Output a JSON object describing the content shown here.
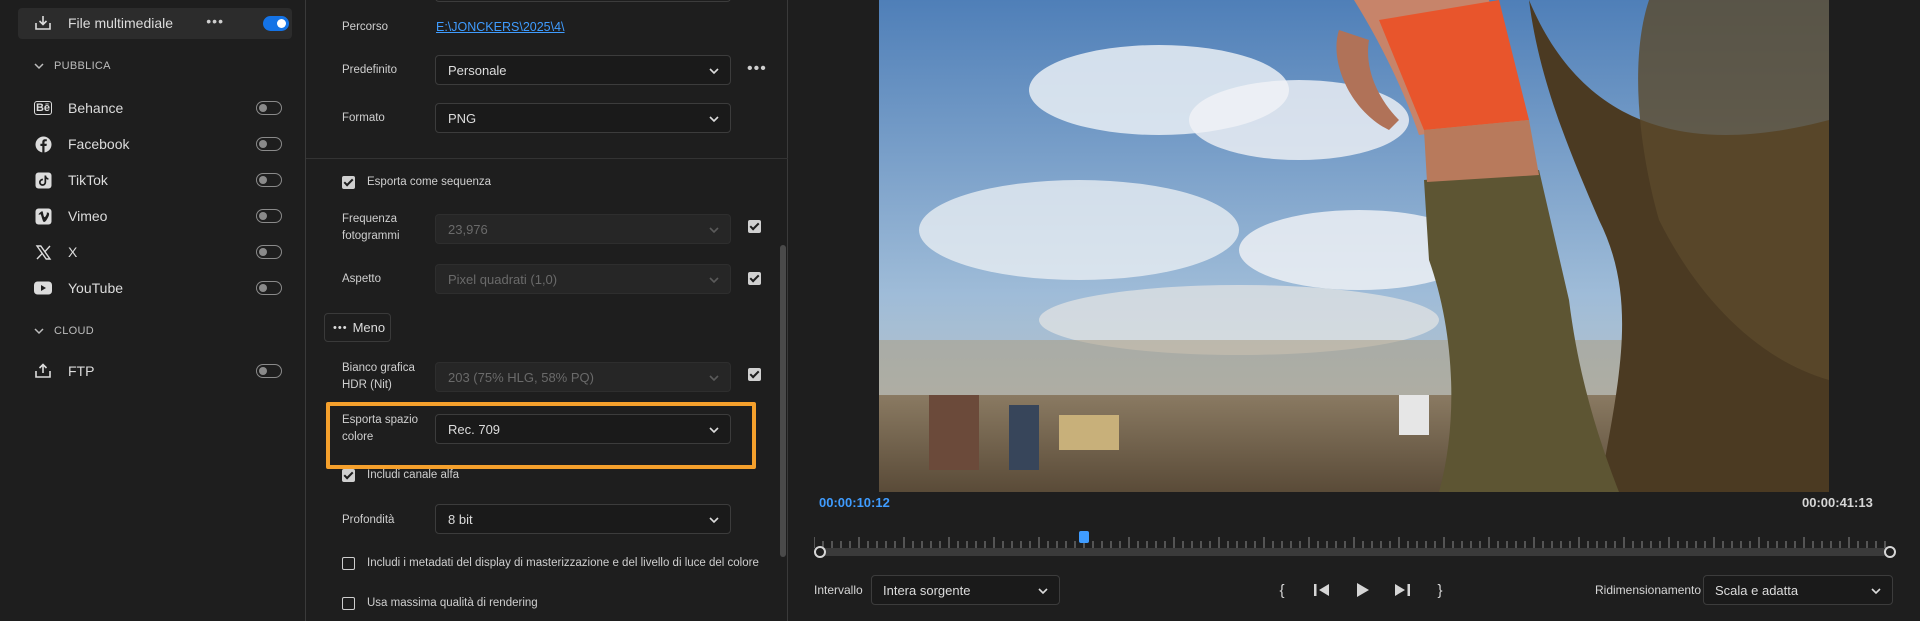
{
  "sidebar": {
    "media_file": {
      "label": "File multimediale",
      "icon": "download-icon",
      "enabled": true
    },
    "publish_section": "PUBBLICA",
    "publish_items": [
      {
        "label": "Behance",
        "icon": "behance-icon"
      },
      {
        "label": "Facebook",
        "icon": "facebook-icon"
      },
      {
        "label": "TikTok",
        "icon": "tiktok-icon"
      },
      {
        "label": "Vimeo",
        "icon": "vimeo-icon"
      },
      {
        "label": "X",
        "icon": "x-icon"
      },
      {
        "label": "YouTube",
        "icon": "youtube-icon"
      }
    ],
    "cloud_section": "CLOUD",
    "cloud_items": [
      {
        "label": "FTP",
        "icon": "upload-icon"
      }
    ]
  },
  "settings": {
    "path_label": "Percorso",
    "path_value": "E:\\JONCKERS\\2025\\4\\",
    "preset_label": "Predefinito",
    "preset_value": "Personale",
    "format_label": "Formato",
    "format_value": "PNG",
    "export_sequence_label": "Esporta come sequenza",
    "export_sequence_checked": true,
    "frame_rate_label_1": "Frequenza",
    "frame_rate_label_2": "fotogrammi",
    "frame_rate_value": "23,976",
    "aspect_label": "Aspetto",
    "aspect_value": "Pixel quadrati (1,0)",
    "less_button": "Meno",
    "hdr_label_1": "Bianco grafica",
    "hdr_label_2": "HDR (Nit)",
    "hdr_value": "203 (75% HLG, 58% PQ)",
    "color_space_label_1": "Esporta spazio",
    "color_space_label_2": "colore",
    "color_space_value": "Rec. 709",
    "alpha_label": "Includi canale alfa",
    "alpha_checked": true,
    "depth_label": "Profondità",
    "depth_value": "8 bit",
    "metadata_label": "Includi i metadati del display di masterizzazione e del livello di luce del colore",
    "max_quality_label": "Usa massima qualità di rendering"
  },
  "preview": {
    "current_time": "00:00:10:12",
    "duration": "00:00:41:13",
    "range_label": "Intervallo",
    "range_value": "Intera sorgente",
    "scale_label": "Ridimensionamento",
    "scale_value": "Scala e adatta"
  },
  "colors": {
    "accent": "#1473e6",
    "link": "#3f9cff",
    "highlight": "#f5a02c",
    "timecode": "#3f9cff"
  }
}
